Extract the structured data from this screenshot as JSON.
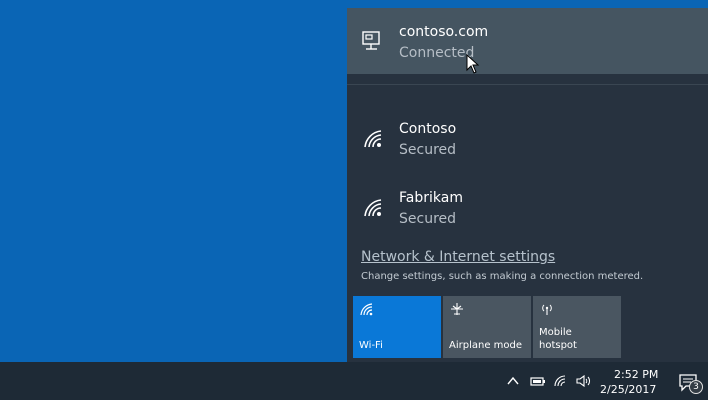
{
  "flyout": {
    "connected": {
      "name": "contoso.com",
      "status": "Connected",
      "icon": "ethernet-icon"
    },
    "networks": [
      {
        "name": "Contoso",
        "status": "Secured",
        "icon": "wifi-icon"
      },
      {
        "name": "Fabrikam",
        "status": "Secured",
        "icon": "wifi-icon"
      }
    ],
    "settings_link": "Network & Internet settings",
    "settings_desc": "Change settings, such as making a connection metered.",
    "quick_actions": [
      {
        "label": "Wi-Fi",
        "icon": "wifi-icon",
        "active": true
      },
      {
        "label": "Airplane mode",
        "icon": "airplane-icon",
        "active": false
      },
      {
        "label_line1": "Mobile",
        "label_line2": "hotspot",
        "icon": "hotspot-icon",
        "active": false
      }
    ]
  },
  "taskbar": {
    "time": "2:52 PM",
    "date": "2/25/2017",
    "notification_count": "3",
    "tray_icons": [
      "chevron-up-icon",
      "battery-icon",
      "wifi-icon",
      "volume-icon"
    ]
  },
  "colors": {
    "desktop": "#0a65b5",
    "flyout_bg": "#27323f",
    "selected_item": "#455561",
    "accent": "#0a78d7",
    "taskbar": "#1e2a36"
  }
}
